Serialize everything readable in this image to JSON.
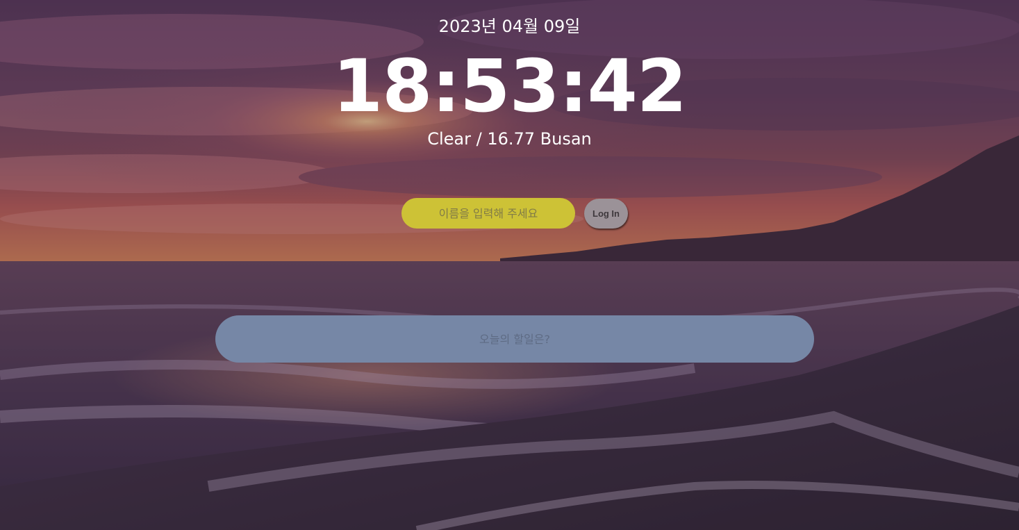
{
  "clock": {
    "date": "2023년 04월 09일",
    "time": "18:53:42"
  },
  "weather": {
    "text": "Clear / 16.77 Busan"
  },
  "login": {
    "placeholder": "이름을 입력해 주세요",
    "button_label": "Log In"
  },
  "todo": {
    "placeholder": "오늘의 할일은?"
  },
  "colors": {
    "name_input_bg": "#cdc236",
    "login_button_bg": "#9b9298",
    "todo_input_bg": "#7687a6"
  }
}
